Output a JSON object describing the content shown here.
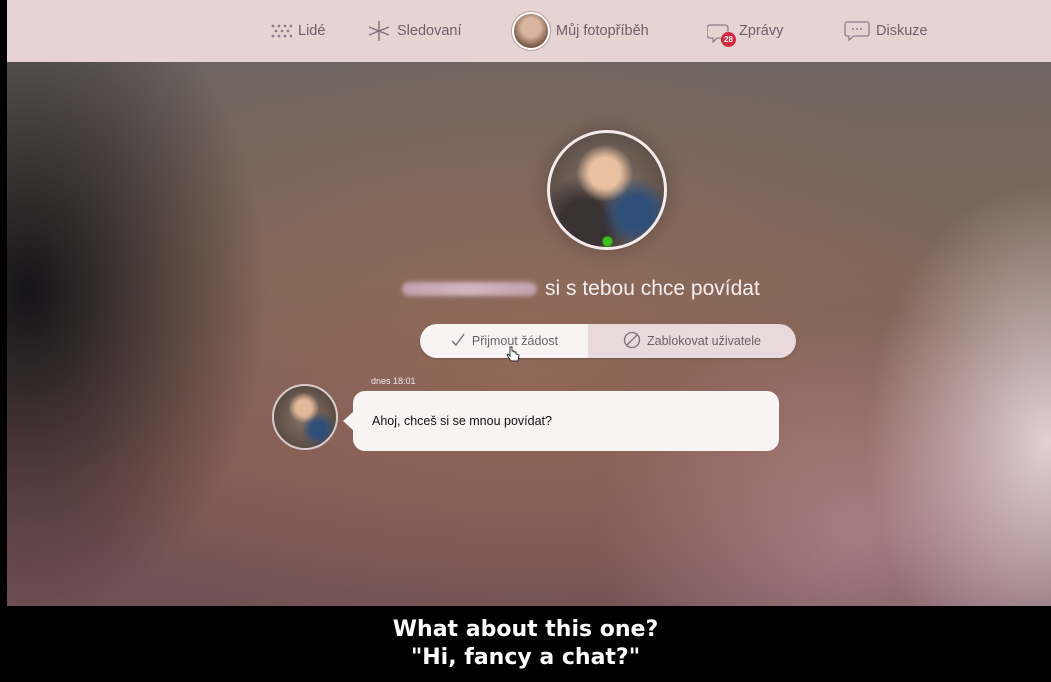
{
  "nav": {
    "items": [
      {
        "label": "Lidé",
        "icon": "people-grid-icon"
      },
      {
        "label": "Sledovaní",
        "icon": "star-icon"
      },
      {
        "label": "Můj fotopříběh",
        "icon": "user-avatar"
      },
      {
        "label": "Zprávy",
        "icon": "messages-icon",
        "badge": "28"
      },
      {
        "label": "Diskuze",
        "icon": "discussion-icon"
      }
    ]
  },
  "request": {
    "text": "si s tebou chce povídat"
  },
  "actions": {
    "accept_label": "Přijmout žádost",
    "block_label": "Zablokovat uživatele"
  },
  "message": {
    "timestamp": "dnes 18:01",
    "text": "Ahoj, chceš si se mnou povídat?"
  },
  "caption": {
    "line1": "What about this one?",
    "line2": "\"Hi, fancy a chat?\""
  },
  "colors": {
    "nav_bg": "#e6d4d3",
    "nav_text": "#6f5f69",
    "online": "#3fc11e",
    "badge": "#d52740"
  }
}
